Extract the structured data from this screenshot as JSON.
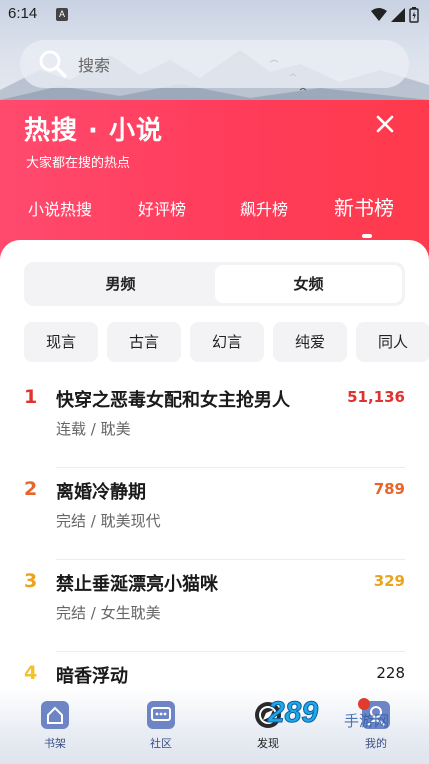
{
  "status_bar": {
    "time": "6:14",
    "notif_icon": "A"
  },
  "search": {
    "placeholder": "搜索"
  },
  "header": {
    "title": "热搜 · 小说",
    "subtitle": "大家都在搜的热点",
    "tabs": [
      {
        "label": "小说热搜",
        "active": false
      },
      {
        "label": "好评榜",
        "active": false
      },
      {
        "label": "飙升榜",
        "active": false
      },
      {
        "label": "新书榜",
        "active": true
      }
    ]
  },
  "gender_tabs": [
    {
      "label": "男频",
      "active": false
    },
    {
      "label": "女频",
      "active": true
    }
  ],
  "categories": [
    "现言",
    "古言",
    "幻言",
    "纯爱",
    "同人"
  ],
  "books": [
    {
      "rank": "1",
      "title": "快穿之恶毒女配和女主抢男人",
      "meta": "连载 / 耽美",
      "count": "51,136",
      "color": "#e0322f"
    },
    {
      "rank": "2",
      "title": "离婚冷静期",
      "meta": "完结 / 耽美现代",
      "count": "789",
      "color": "#e9642a"
    },
    {
      "rank": "3",
      "title": "禁止垂涎漂亮小猫咪",
      "meta": "完结 / 女生耽美",
      "count": "329",
      "color": "#eea21c"
    },
    {
      "rank": "4",
      "title": "暗香浮动",
      "meta": "",
      "count": "228",
      "color": "#f2c12b"
    }
  ],
  "bottom_nav": [
    {
      "label": "书架",
      "icon": "bookshelf-icon"
    },
    {
      "label": "社区",
      "icon": "community-icon"
    },
    {
      "label": "发现",
      "icon": "discover-icon",
      "active": true
    },
    {
      "label": "我的",
      "icon": "profile-icon"
    }
  ],
  "watermark": "289手游网",
  "colors": {
    "accent_red": "#ff3d5c",
    "nav_blue": "#3b4f87"
  }
}
